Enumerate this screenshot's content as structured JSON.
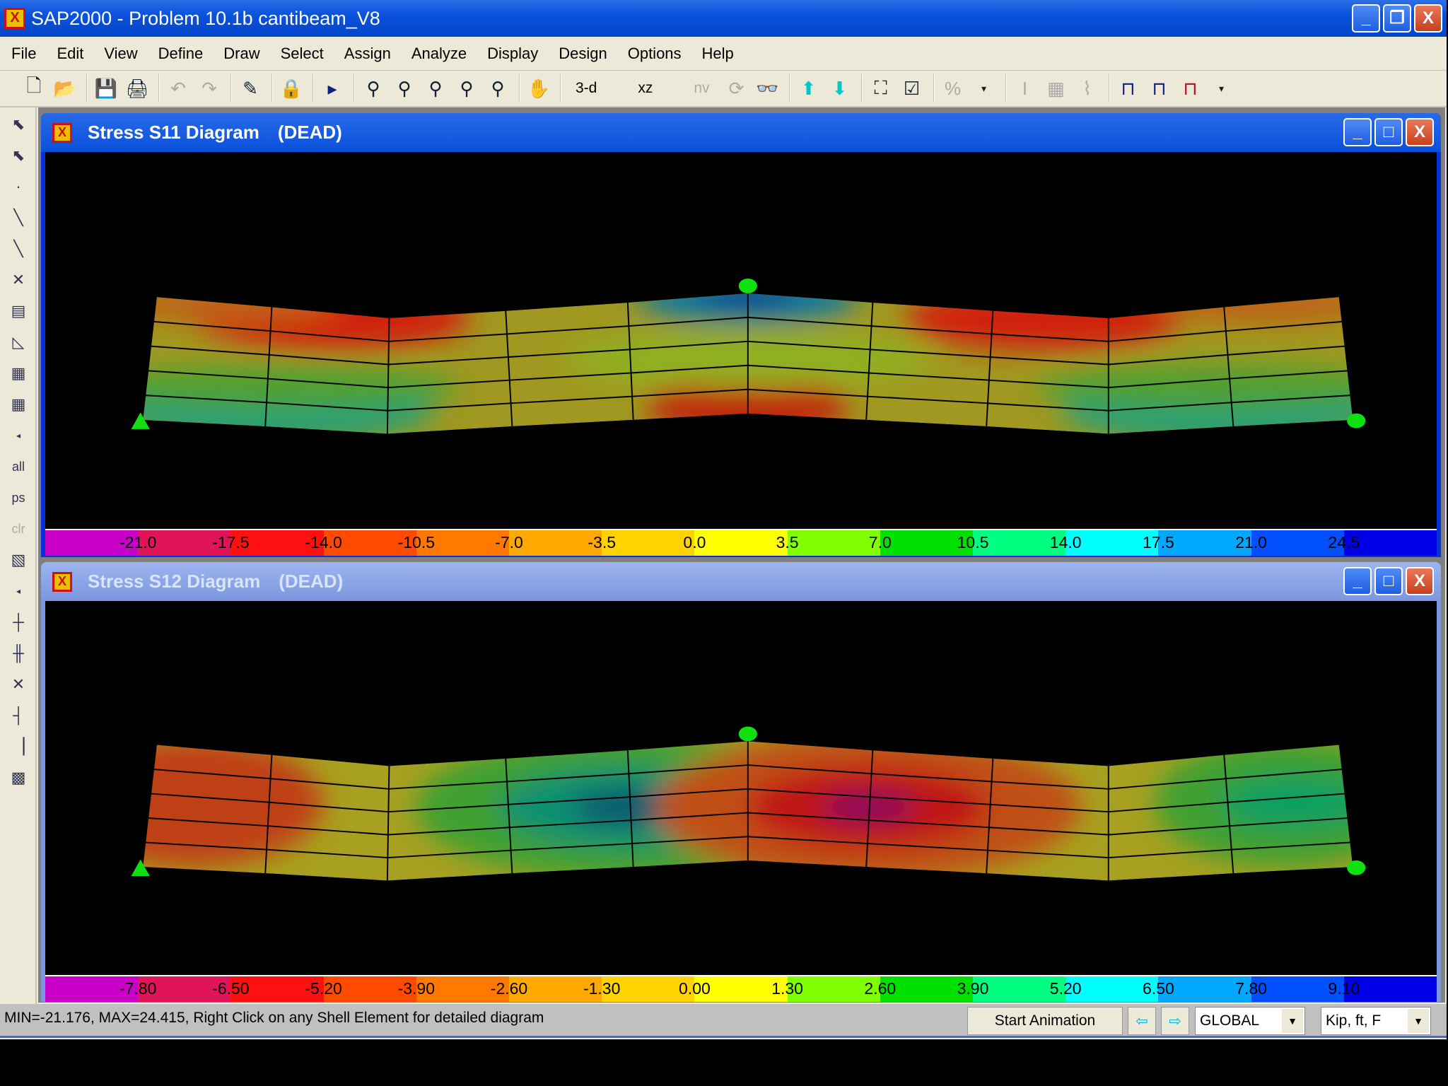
{
  "app": {
    "title": "SAP2000 - Problem 10.1b cantibeam_V8",
    "icon": "sap-logo-icon"
  },
  "menu": [
    "File",
    "Edit",
    "View",
    "Define",
    "Draw",
    "Select",
    "Assign",
    "Analyze",
    "Display",
    "Design",
    "Options",
    "Help"
  ],
  "toolbar": {
    "view_3d": "3-d",
    "view_xz": "xz",
    "view_nv": "nv"
  },
  "left_toolbar": {
    "all": "all",
    "ps": "ps",
    "clr": "clr"
  },
  "windows": [
    {
      "title": "Stress S11 Diagram",
      "load_case": "(DEAD)",
      "active": true,
      "colorbar": {
        "labels": [
          "-21.0",
          "-17.5",
          "-14.0",
          "-10.5",
          "-7.0",
          "-3.5",
          "0.0",
          "3.5",
          "7.0",
          "10.5",
          "14.0",
          "17.5",
          "21.0",
          "24.5"
        ]
      }
    },
    {
      "title": "Stress S12 Diagram",
      "load_case": "(DEAD)",
      "active": false,
      "colorbar": {
        "labels": [
          "-7.80",
          "-6.50",
          "-5.20",
          "-3.90",
          "-2.60",
          "-1.30",
          "0.00",
          "1.30",
          "2.60",
          "3.90",
          "5.20",
          "6.50",
          "7.80",
          "9.10"
        ]
      }
    }
  ],
  "colorbar_colors": [
    "#c800c8",
    "#e0145a",
    "#ff1010",
    "#ff4a00",
    "#ff7800",
    "#ffa800",
    "#ffd200",
    "#ffff00",
    "#80ff00",
    "#00e000",
    "#00ff80",
    "#00ffff",
    "#00a8ff",
    "#0050ff",
    "#0000e6"
  ],
  "status": {
    "message": "MIN=-21.176, MAX=24.415, Right Click on any Shell Element for detailed diagram",
    "start_animation": "Start Animation",
    "coord_system": "GLOBAL",
    "units": "Kip, ft, F"
  }
}
